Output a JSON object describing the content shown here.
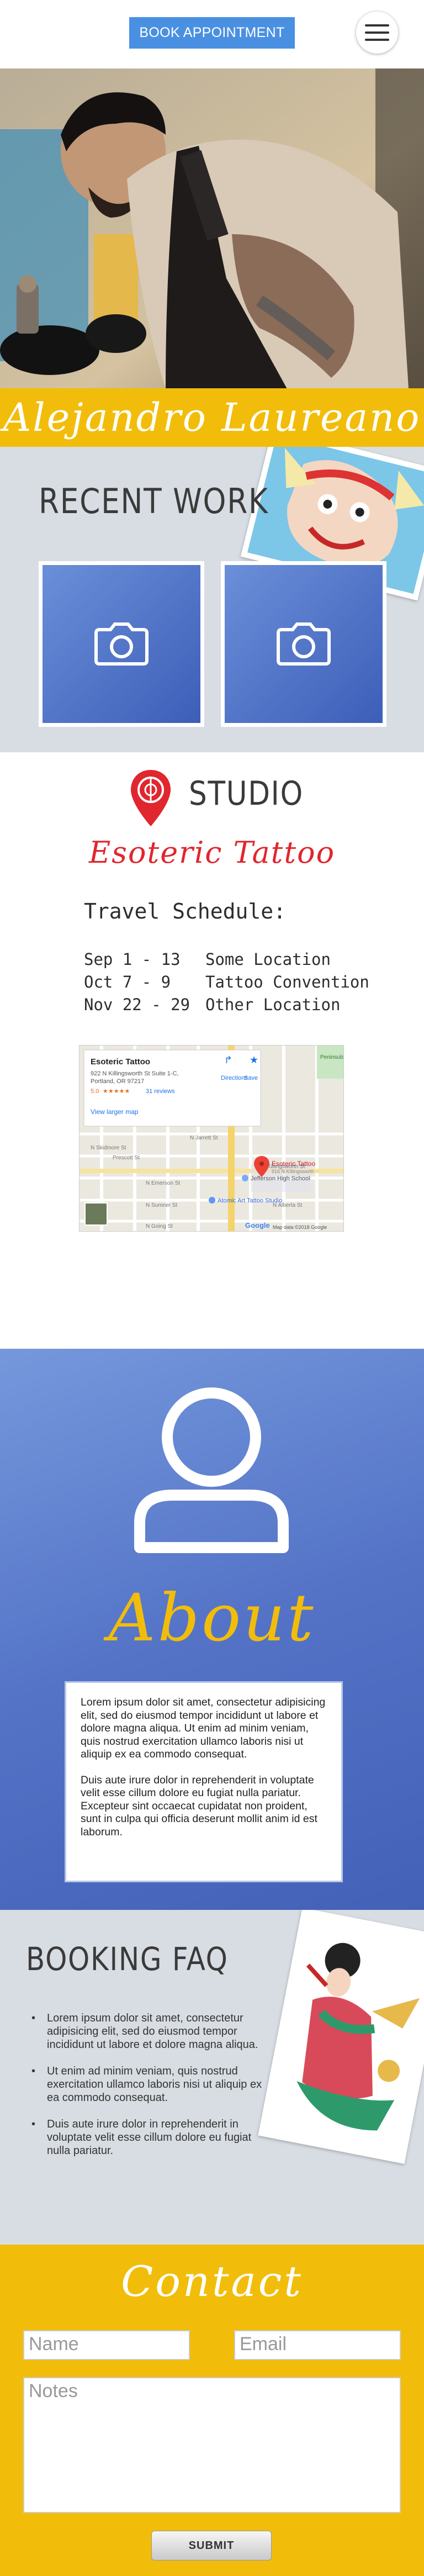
{
  "header": {
    "book_label": "BOOK APPOINTMENT",
    "menu_icon": "hamburger-menu-icon"
  },
  "hero": {
    "artist_name": "Alejandro Laureano",
    "image_subject": "tattoo-artist-working-photo"
  },
  "recent_work": {
    "title": "RECENT WORK",
    "photos": [
      {
        "icon": "camera-icon"
      },
      {
        "icon": "camera-icon"
      }
    ]
  },
  "studio": {
    "title": "STUDIO",
    "name": "Esoteric Tattoo",
    "travel_title": "Travel Schedule:",
    "schedule": [
      {
        "dates": "Sep 1 - 13",
        "location": "Some Location"
      },
      {
        "dates": "Oct 7 - 9",
        "location": "Tattoo Convention"
      },
      {
        "dates": "Nov 22 - 29",
        "location": "Other Location"
      }
    ],
    "map": {
      "place_name": "Esoteric Tattoo",
      "address_line1": "922 N Killingsworth St Suite 1-C,",
      "address_line2": "Portland, OR 97217",
      "rating": "5.0",
      "stars": "★★★★★",
      "reviews": "31 reviews",
      "directions": "Directions",
      "save": "Save",
      "larger_map": "View larger map",
      "pin_label": "Esoteric Tattoo",
      "pin_sublabel": "916 N Killingsworth",
      "poi1": "Jefferson High School",
      "poi2": "Atomic Art Tattoo Studio",
      "poi3": "Peninsula Park Rose Garden",
      "streets": [
        "N Jarrett St",
        "N Killingsworth St",
        "N Emerson St",
        "N Sumner St",
        "N Alberta St",
        "N Going St",
        "N Skidmore St",
        "Prescott St"
      ],
      "google": "Google",
      "attribution": "Map data ©2018 Google"
    }
  },
  "about": {
    "title": "About",
    "icon": "user-avatar-icon",
    "paragraph1": "Lorem ipsum dolor sit amet, consectetur adipisicing elit, sed do eiusmod tempor incididunt ut labore et dolore magna aliqua. Ut enim ad minim veniam, quis nostrud exercitation ullamco laboris nisi ut aliquip ex ea commodo consequat.",
    "paragraph2": "Duis aute irure dolor in reprehenderit in voluptate velit esse cillum dolore eu fugiat nulla pariatur. Excepteur sint occaecat cupidatat non proident, sunt in culpa qui officia deserunt mollit anim id est laborum."
  },
  "faq": {
    "title": "BOOKING FAQ",
    "items": [
      "Lorem ipsum dolor sit amet, consectetur adipisicing elit, sed do eiusmod tempor incididunt ut labore et dolore magna aliqua.",
      "Ut enim ad minim veniam, quis nostrud exercitation ullamco laboris nisi ut aliquip ex ea commodo consequat.",
      "Duis aute irure dolor in reprehenderit in voluptate velit esse cillum dolore eu fugiat nulla pariatur."
    ]
  },
  "contact": {
    "title": "Contact",
    "name_placeholder": "Name",
    "email_placeholder": "Email",
    "notes_placeholder": "Notes",
    "submit_label": "SUBMIT"
  },
  "colors": {
    "accent_blue": "#4a90e2",
    "brand_yellow": "#f2bd0a",
    "studio_red": "#e0262e",
    "gray_bg": "#d8dde3"
  }
}
